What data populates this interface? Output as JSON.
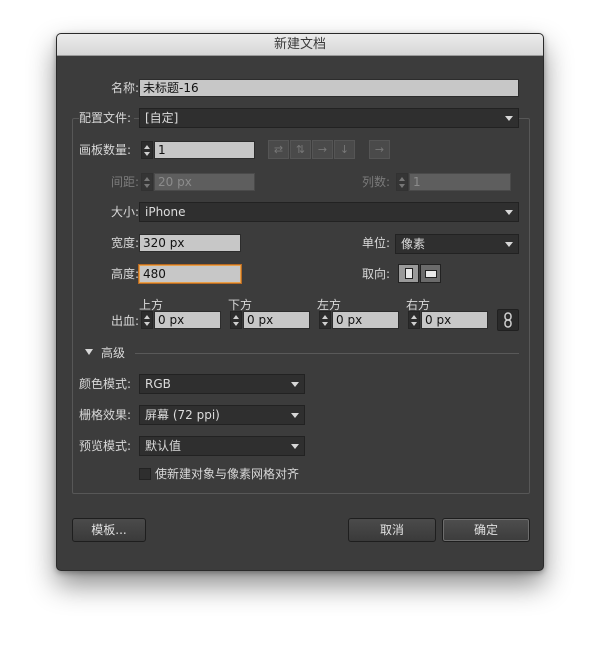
{
  "dialog": {
    "title": "新建文档",
    "name_label": "名称:",
    "name_value": "未标题-16",
    "profile_label": "配置文件:",
    "profile_value": "[自定]",
    "artboards_label": "画板数量:",
    "artboards_value": "1",
    "artboard_layout_icons": [
      "grid-by-row-icon",
      "grid-by-column-icon",
      "arrange-by-row-icon",
      "arrange-by-column-icon",
      "right-to-left-icon"
    ],
    "spacing_label": "间距:",
    "spacing_value": "20 px",
    "columns_label": "列数:",
    "columns_value": "1",
    "size_label": "大小:",
    "size_value": "iPhone",
    "width_label": "宽度:",
    "width_value": "320 px",
    "units_label": "单位:",
    "units_value": "像素",
    "height_label": "高度:",
    "height_value": "480",
    "orientation_label": "取向:",
    "bleed_label": "出血:",
    "bleed": [
      {
        "label": "上方",
        "value": "0 px"
      },
      {
        "label": "下方",
        "value": "0 px"
      },
      {
        "label": "左方",
        "value": "0 px"
      },
      {
        "label": "右方",
        "value": "0 px"
      }
    ],
    "advanced_label": "高级",
    "color_mode_label": "颜色模式:",
    "color_mode_value": "RGB",
    "raster_label": "栅格效果:",
    "raster_value": "屏幕 (72 ppi)",
    "preview_label": "预览模式:",
    "preview_value": "默认值",
    "align_pixel_label": "使新建对象与像素网格对齐",
    "templates_button": "模板...",
    "cancel_button": "取消",
    "ok_button": "确定"
  },
  "colors": {
    "dialog_bg": "#3c3c3c",
    "field_bg": "#c7c7c7",
    "focus_ring": "#e8a04a"
  }
}
